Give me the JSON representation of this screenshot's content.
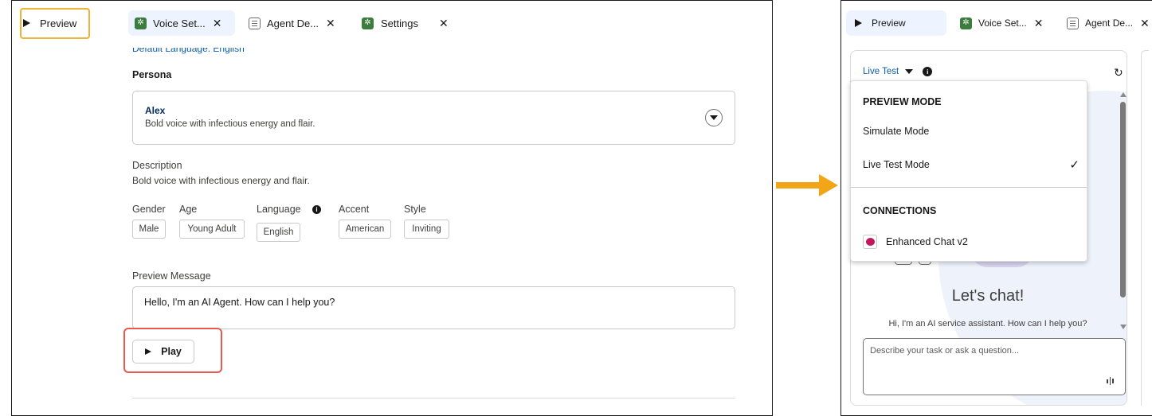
{
  "left": {
    "tabs": {
      "preview": "Preview",
      "voice": "Voice Set...",
      "agent": "Agent De...",
      "settings": "Settings"
    },
    "partial_text": "Default Language: English",
    "persona_heading": "Persona",
    "persona": {
      "name": "Alex",
      "desc": "Bold voice with infectious energy and flair."
    },
    "description_label": "Description",
    "description_text": "Bold voice with infectious energy and flair.",
    "attributes": {
      "gender_label": "Gender",
      "gender_value": "Male",
      "age_label": "Age",
      "age_value": "Young Adult",
      "language_label": "Language",
      "language_value": "English",
      "accent_label": "Accent",
      "accent_value": "American",
      "style_label": "Style",
      "style_value": "Inviting"
    },
    "preview_message_label": "Preview Message",
    "preview_message_value": "Hello, I'm an AI Agent. How can I help you?",
    "play_label": "Play"
  },
  "right": {
    "tabs": {
      "preview": "Preview",
      "voice": "Voice Set...",
      "agent": "Agent De..."
    },
    "mode_selector": "Live Test",
    "menu": {
      "section1": "PREVIEW MODE",
      "simulate": "Simulate Mode",
      "live": "Live Test Mode",
      "section2": "CONNECTIONS",
      "connection": "Enhanced Chat v2"
    },
    "chat": {
      "heading": "Let's chat!",
      "subtitle": "Hi, I'm an AI service assistant. How can I help you?",
      "placeholder": "Describe your task or ask a question..."
    }
  },
  "colors": {
    "highlight_orange": "#f2b233",
    "highlight_red": "#e8584f",
    "arrow": "#f2a516",
    "link_blue": "#0b5cab",
    "tab_selected_bg": "#eef4ff",
    "gear_green": "#3a7d3c",
    "chat_icon_pink": "#c2185b"
  }
}
